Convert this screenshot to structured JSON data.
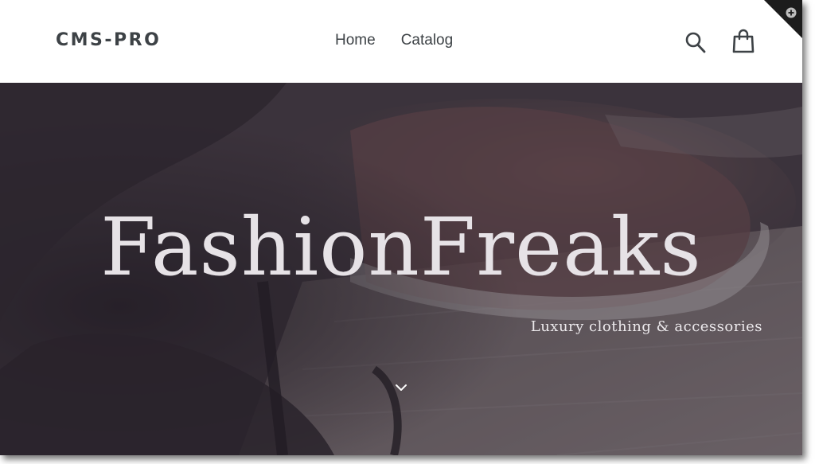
{
  "header": {
    "logo": "CMS-PRO",
    "nav": [
      {
        "label": "Home"
      },
      {
        "label": "Catalog"
      }
    ],
    "icons": {
      "search": "search-icon",
      "cart": "shopping-bag-icon",
      "corner": "plus-circle-icon"
    }
  },
  "hero": {
    "title": "FashionFreaks",
    "subtitle": "Luxury clothing & accessories",
    "scroll_icon": "chevron-down-icon"
  },
  "colors": {
    "text_dark": "#3d4246",
    "hero_text": "#e6e2e6",
    "hero_bg": "#4a3f47"
  }
}
